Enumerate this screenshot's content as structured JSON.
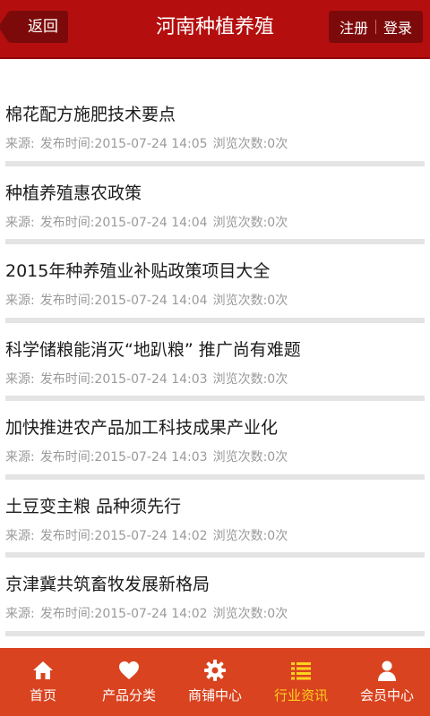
{
  "header": {
    "back_label": "返回",
    "title": "河南种植养殖",
    "register_label": "注册",
    "login_label": "登录",
    "brand_color": "#b50e0e"
  },
  "news": [
    {
      "title": "棉花配方施肥技术要点",
      "source": "来源:",
      "time": "发布时间:2015-07-24 14:05",
      "views": "浏览次数:0次"
    },
    {
      "title": "种植养殖惠农政策",
      "source": "来源:",
      "time": "发布时间:2015-07-24 14:04",
      "views": "浏览次数:0次"
    },
    {
      "title": "2015年种养殖业补贴政策项目大全",
      "source": "来源:",
      "time": "发布时间:2015-07-24 14:04",
      "views": "浏览次数:0次"
    },
    {
      "title": "科学储粮能消灭“地趴粮” 推广尚有难题",
      "source": "来源:",
      "time": "发布时间:2015-07-24 14:03",
      "views": "浏览次数:0次"
    },
    {
      "title": "加快推进农产品加工科技成果产业化",
      "source": "来源:",
      "time": "发布时间:2015-07-24 14:03",
      "views": "浏览次数:0次"
    },
    {
      "title": "土豆变主粮 品种须先行",
      "source": "来源:",
      "time": "发布时间:2015-07-24 14:02",
      "views": "浏览次数:0次"
    },
    {
      "title": "京津冀共筑畜牧发展新格局",
      "source": "来源:",
      "time": "发布时间:2015-07-24 14:02",
      "views": "浏览次数:0次"
    }
  ],
  "tabbar": {
    "background": "#d9431f",
    "active_color": "#ffd21f",
    "tabs": [
      {
        "label": "首页",
        "icon": "home-icon",
        "active": false
      },
      {
        "label": "产品分类",
        "icon": "heart-icon",
        "active": false
      },
      {
        "label": "商铺中心",
        "icon": "gear-icon",
        "active": false
      },
      {
        "label": "行业资讯",
        "icon": "list-icon",
        "active": true
      },
      {
        "label": "会员中心",
        "icon": "user-icon",
        "active": false
      }
    ]
  }
}
